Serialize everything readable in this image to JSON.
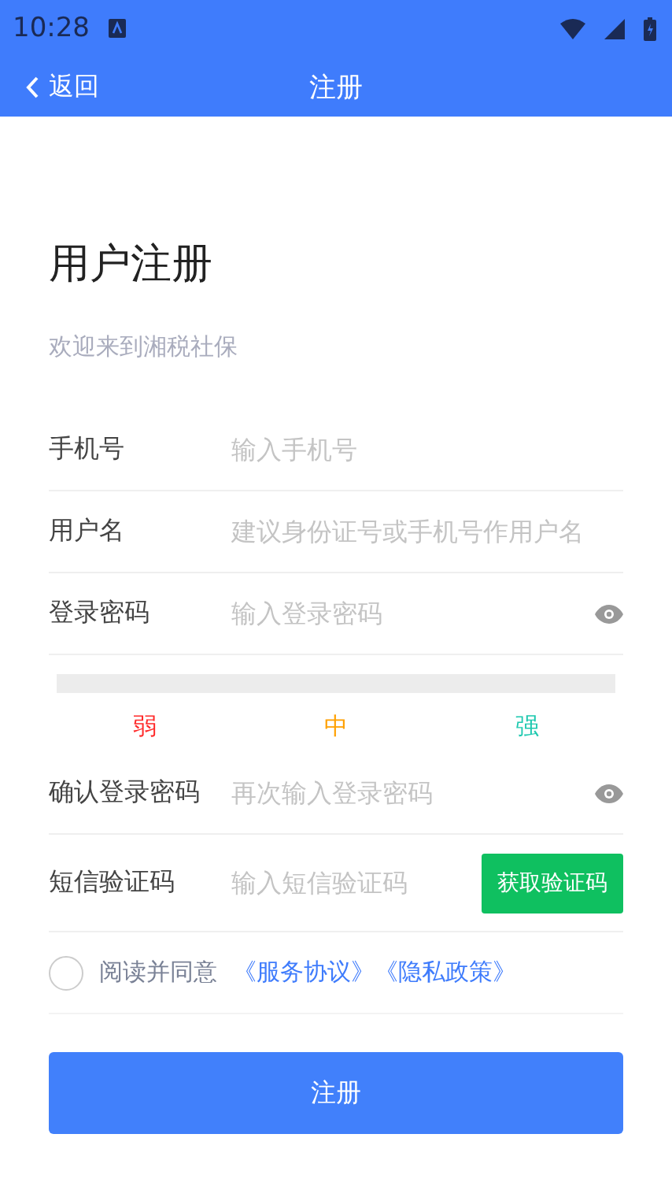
{
  "status_bar": {
    "time": "10:28"
  },
  "header": {
    "back": "返回",
    "title": "注册"
  },
  "heading": "用户注册",
  "subtitle": "欢迎来到湘税社保",
  "fields": [
    {
      "kind": "plain",
      "label": "手机号",
      "placeholder": "输入手机号"
    },
    {
      "kind": "plain",
      "label": "用户名",
      "placeholder": "建议身份证号或手机号作用户名"
    },
    {
      "kind": "password",
      "label": "登录密码",
      "placeholder": "输入登录密码"
    }
  ],
  "strength": {
    "level": 0,
    "labels": [
      {
        "text": "弱",
        "color": "#ff2a2a"
      },
      {
        "text": "中",
        "color": "#ffa000"
      },
      {
        "text": "强",
        "color": "#1fc9b0"
      }
    ]
  },
  "fields2": [
    {
      "kind": "password",
      "label": "确认登录密码",
      "placeholder": "再次输入登录密码"
    },
    {
      "kind": "sms",
      "label": "短信验证码",
      "placeholder": "输入短信验证码",
      "button": "获取验证码"
    }
  ],
  "agreement": {
    "checked": false,
    "text": "阅读并同意",
    "links": [
      "《服务协议》",
      "《隐私政策》"
    ]
  },
  "submit": "注册"
}
